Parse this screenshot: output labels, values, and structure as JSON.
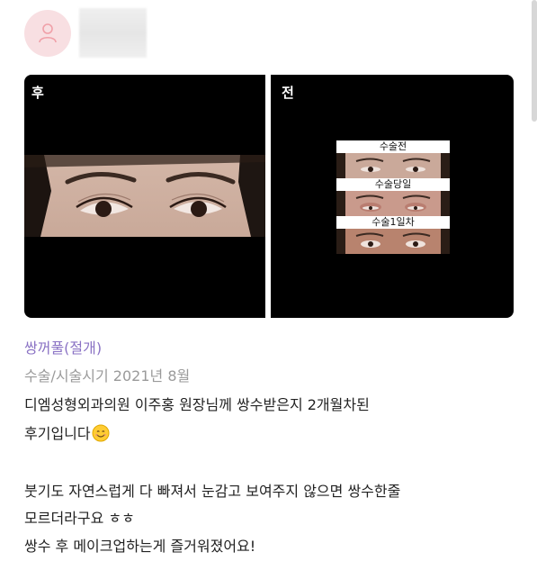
{
  "post": {
    "photo_labels": {
      "after": "후",
      "before": "전"
    },
    "before_stages": [
      "수술전",
      "수술당일",
      "수술1일차"
    ],
    "tag": "쌍꺼풀(절개)",
    "surgery_time": "수술/시술시기 2021년 8월",
    "body_lines": [
      "디엠성형외과의원 이주홍 원장님께 쌍수받은지 2개월차된",
      "후기입니다",
      "",
      "붓기도 자연스럽게 다 빠져서 눈감고 보여주지 않으면 쌍수한줄",
      "모르더라구요 ㅎㅎ",
      "쌍수 후 메이크업하는게 즐거워졌어요!"
    ],
    "emoji": "smiling-face-emoji"
  },
  "colors": {
    "tag": "#8a72c4",
    "meta": "#9a9a9a",
    "avatar_bg": "#f8dfe2",
    "avatar_icon": "#f0a0a8"
  }
}
